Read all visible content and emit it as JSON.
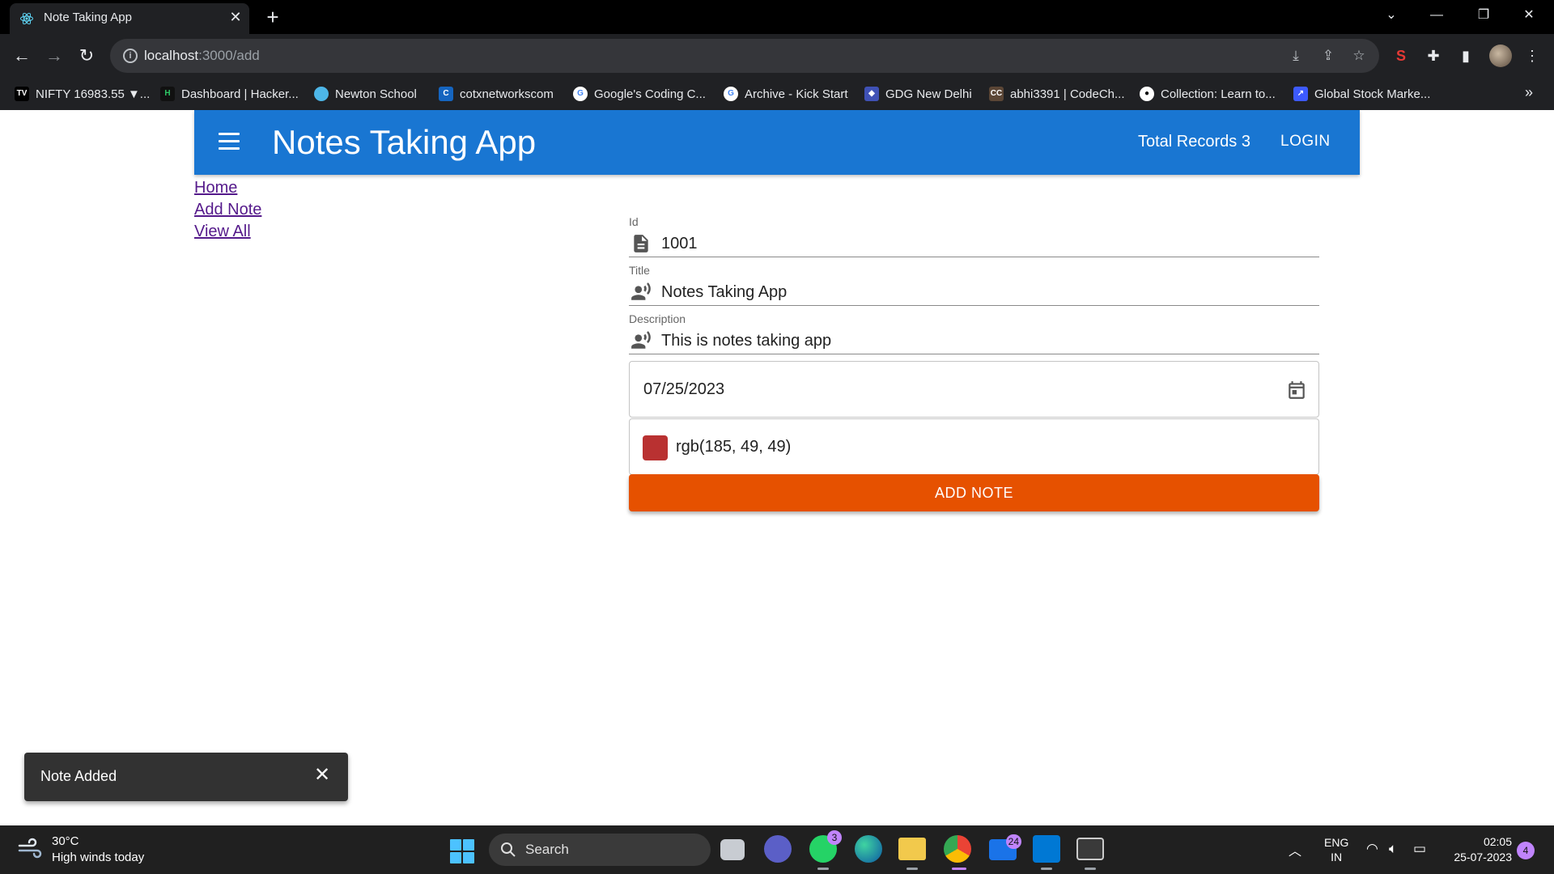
{
  "browser": {
    "tab_title": "Note Taking App",
    "url_host": "localhost",
    "url_path": ":3000/add",
    "bookmarks": [
      {
        "label": "NIFTY 16983.55 ▼...",
        "icon": "tv-icon",
        "color": "#000000"
      },
      {
        "label": "Dashboard | Hacker...",
        "icon": "hackerrank-icon",
        "color": "#111111"
      },
      {
        "label": "Newton School",
        "icon": "newton-icon",
        "color": "#4db6e8"
      },
      {
        "label": "cotxnetworkscom",
        "icon": "cotx-icon",
        "color": "#1565c0"
      },
      {
        "label": "Google's Coding C...",
        "icon": "google-icon",
        "color": "#ffffff"
      },
      {
        "label": "Archive - Kick Start",
        "icon": "google-icon",
        "color": "#ffffff"
      },
      {
        "label": "GDG New Delhi",
        "icon": "gdg-icon",
        "color": "#3f51b5"
      },
      {
        "label": "abhi3391 | CodeCh...",
        "icon": "codechef-icon",
        "color": "#5b4636"
      },
      {
        "label": "Collection: Learn to...",
        "icon": "github-icon",
        "color": "#ffffff"
      },
      {
        "label": "Global Stock Marke...",
        "icon": "stock-icon",
        "color": "#3d5afe"
      }
    ]
  },
  "appbar": {
    "title": "Notes Taking App",
    "total_records": "Total Records 3",
    "login": "LOGIN"
  },
  "nav": {
    "home": "Home",
    "add_note": "Add Note",
    "view_all": "View All"
  },
  "form": {
    "id_label": "Id",
    "id_value": "1001",
    "title_label": "Title",
    "title_value": "Notes Taking App",
    "description_label": "Description",
    "description_value": "This is notes taking app",
    "date_value": "07/25/2023",
    "color_value": "rgb(185, 49, 49)",
    "color_hex": "#b93131",
    "submit_label": "ADD NOTE"
  },
  "snackbar": {
    "message": "Note Added"
  },
  "taskbar": {
    "weather_temp": "30°C",
    "weather_desc": "High winds today",
    "search_label": "Search",
    "whatsapp_badge": "3",
    "mail_badge": "24",
    "lang_top": "ENG",
    "lang_bottom": "IN",
    "time": "02:05",
    "date": "25-07-2023",
    "notifications": "4"
  },
  "colors": {
    "appbar": "#1976d2",
    "submit": "#e65100",
    "link": "#551a8b"
  }
}
